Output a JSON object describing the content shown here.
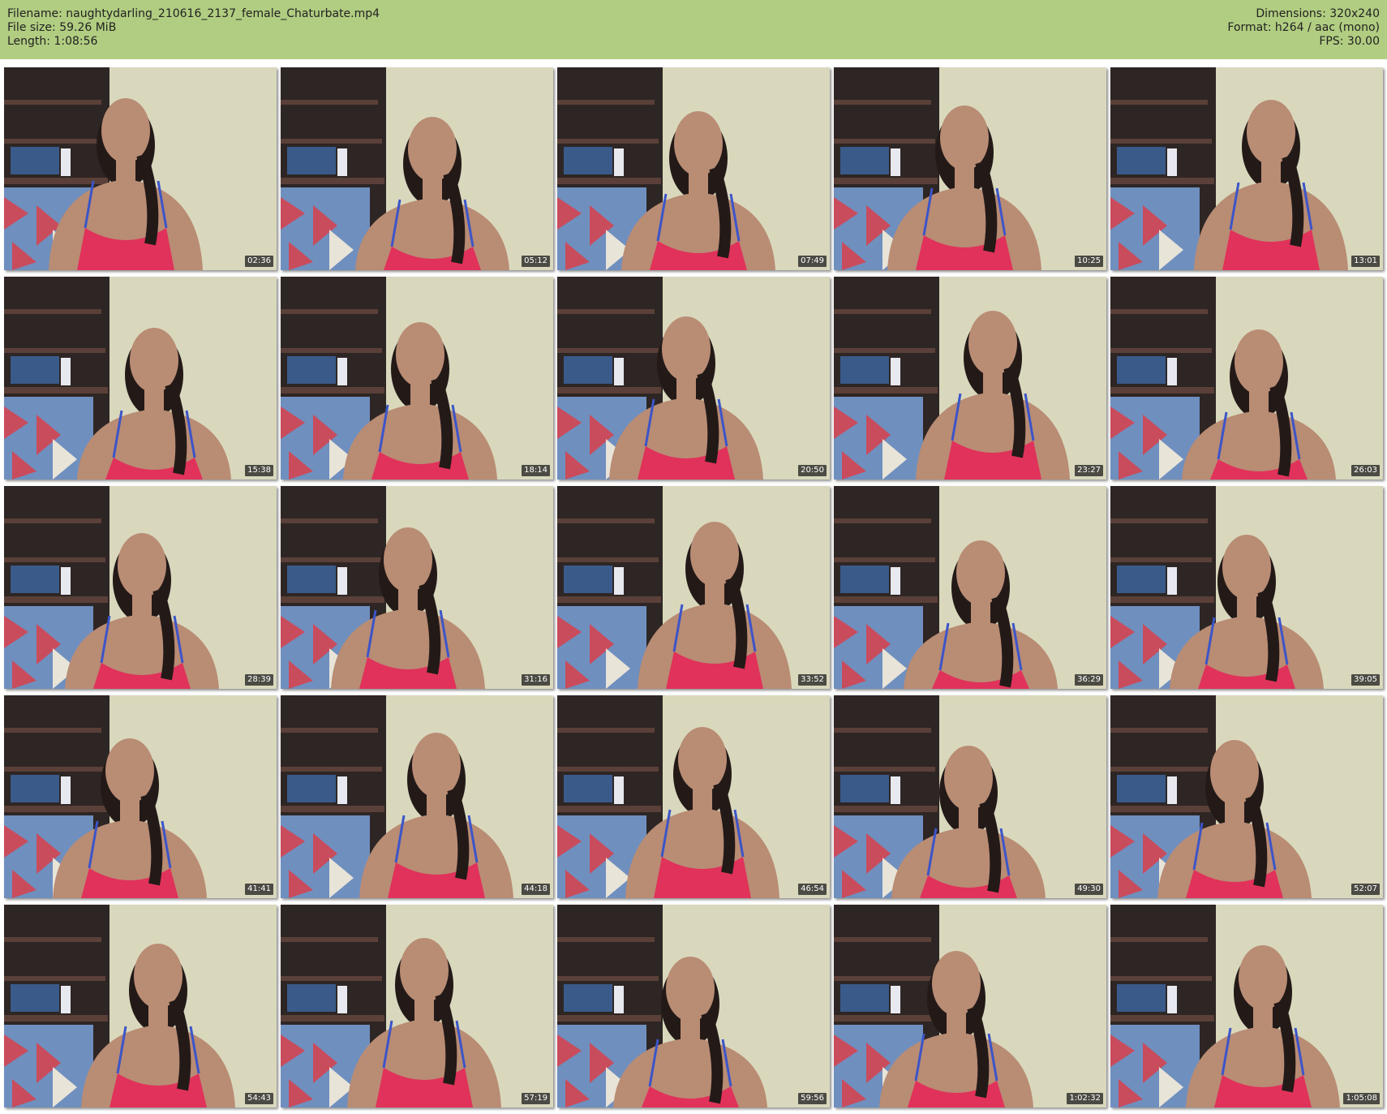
{
  "header": {
    "filename": "Filename: naughtydarling_210616_2137_female_Chaturbate.mp4",
    "file_size": "File size: 59.26 MiB",
    "length": "Length: 1:08:56",
    "dimensions": "Dimensions: 320x240",
    "format": "Format: h264 / aac (mono)",
    "fps": "FPS: 30.00"
  },
  "thumbnails": [
    {
      "time": "02:36"
    },
    {
      "time": "05:12"
    },
    {
      "time": "07:49"
    },
    {
      "time": "10:25"
    },
    {
      "time": "13:01"
    },
    {
      "time": "15:38"
    },
    {
      "time": "18:14"
    },
    {
      "time": "20:50"
    },
    {
      "time": "23:27"
    },
    {
      "time": "26:03"
    },
    {
      "time": "28:39"
    },
    {
      "time": "31:16"
    },
    {
      "time": "33:52"
    },
    {
      "time": "36:29"
    },
    {
      "time": "39:05"
    },
    {
      "time": "41:41"
    },
    {
      "time": "44:18"
    },
    {
      "time": "46:54"
    },
    {
      "time": "49:30"
    },
    {
      "time": "52:07"
    },
    {
      "time": "54:43"
    },
    {
      "time": "57:19"
    },
    {
      "time": "59:56"
    },
    {
      "time": "1:02:32"
    },
    {
      "time": "1:05:08"
    }
  ],
  "colors": {
    "header_bg": "#b1cd81",
    "wall": "#d9d8bd",
    "shelf": "#2e2624",
    "top": "#e0325a",
    "strap": "#3c55c8",
    "skin": "#b98c74",
    "hair": "#231a18"
  }
}
